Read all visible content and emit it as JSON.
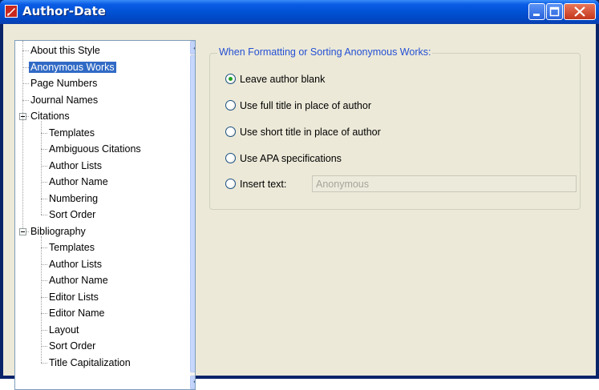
{
  "window": {
    "title": "Author-Date",
    "colors": {
      "titlebar": "#0152d4",
      "selection": "#316ac5",
      "group_label": "#2450d4",
      "radio_dot": "#21a121"
    }
  },
  "tree": {
    "items": [
      {
        "label": "About this Style",
        "level": 0
      },
      {
        "label": "Anonymous Works",
        "level": 0,
        "selected": true
      },
      {
        "label": "Page Numbers",
        "level": 0
      },
      {
        "label": "Journal Names",
        "level": 0
      },
      {
        "label": "Citations",
        "level": 0,
        "expander": "minus"
      },
      {
        "label": "Templates",
        "level": 1
      },
      {
        "label": "Ambiguous Citations",
        "level": 1
      },
      {
        "label": "Author Lists",
        "level": 1
      },
      {
        "label": "Author Name",
        "level": 1
      },
      {
        "label": "Numbering",
        "level": 1
      },
      {
        "label": "Sort Order",
        "level": 1
      },
      {
        "label": "Bibliography",
        "level": 0,
        "expander": "minus"
      },
      {
        "label": "Templates",
        "level": 1
      },
      {
        "label": "Author Lists",
        "level": 1
      },
      {
        "label": "Author Name",
        "level": 1
      },
      {
        "label": "Editor Lists",
        "level": 1
      },
      {
        "label": "Editor Name",
        "level": 1
      },
      {
        "label": "Layout",
        "level": 1
      },
      {
        "label": "Sort Order",
        "level": 1
      },
      {
        "label": "Title Capitalization",
        "level": 1
      }
    ]
  },
  "panel": {
    "group_label": "When Formatting or Sorting Anonymous Works:",
    "options": [
      {
        "label": "Leave author blank",
        "checked": true
      },
      {
        "label": "Use full title in place of author",
        "checked": false
      },
      {
        "label": "Use short title in place of author",
        "checked": false
      },
      {
        "label": "Use APA specifications",
        "checked": false
      },
      {
        "label": "Insert text:",
        "checked": false
      }
    ],
    "insert_text_value": "Anonymous"
  }
}
